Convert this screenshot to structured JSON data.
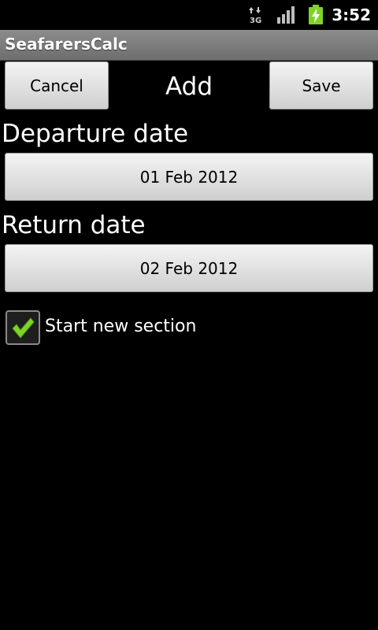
{
  "status_bar": {
    "time": "3:52",
    "network_label": "3G",
    "icons": [
      "data-activity-icon",
      "signal-icon",
      "battery-charging-icon"
    ]
  },
  "app": {
    "title": "SeafarersCalc"
  },
  "header": {
    "cancel_label": "Cancel",
    "title": "Add",
    "save_label": "Save"
  },
  "form": {
    "departure_label": "Departure date",
    "departure_value": "01 Feb 2012",
    "return_label": "Return date",
    "return_value": "02 Feb 2012",
    "new_section_label": "Start new section",
    "new_section_checked": true
  },
  "colors": {
    "background": "#000000",
    "title_bar": "#7d7d7d",
    "check": "#7fd327"
  }
}
